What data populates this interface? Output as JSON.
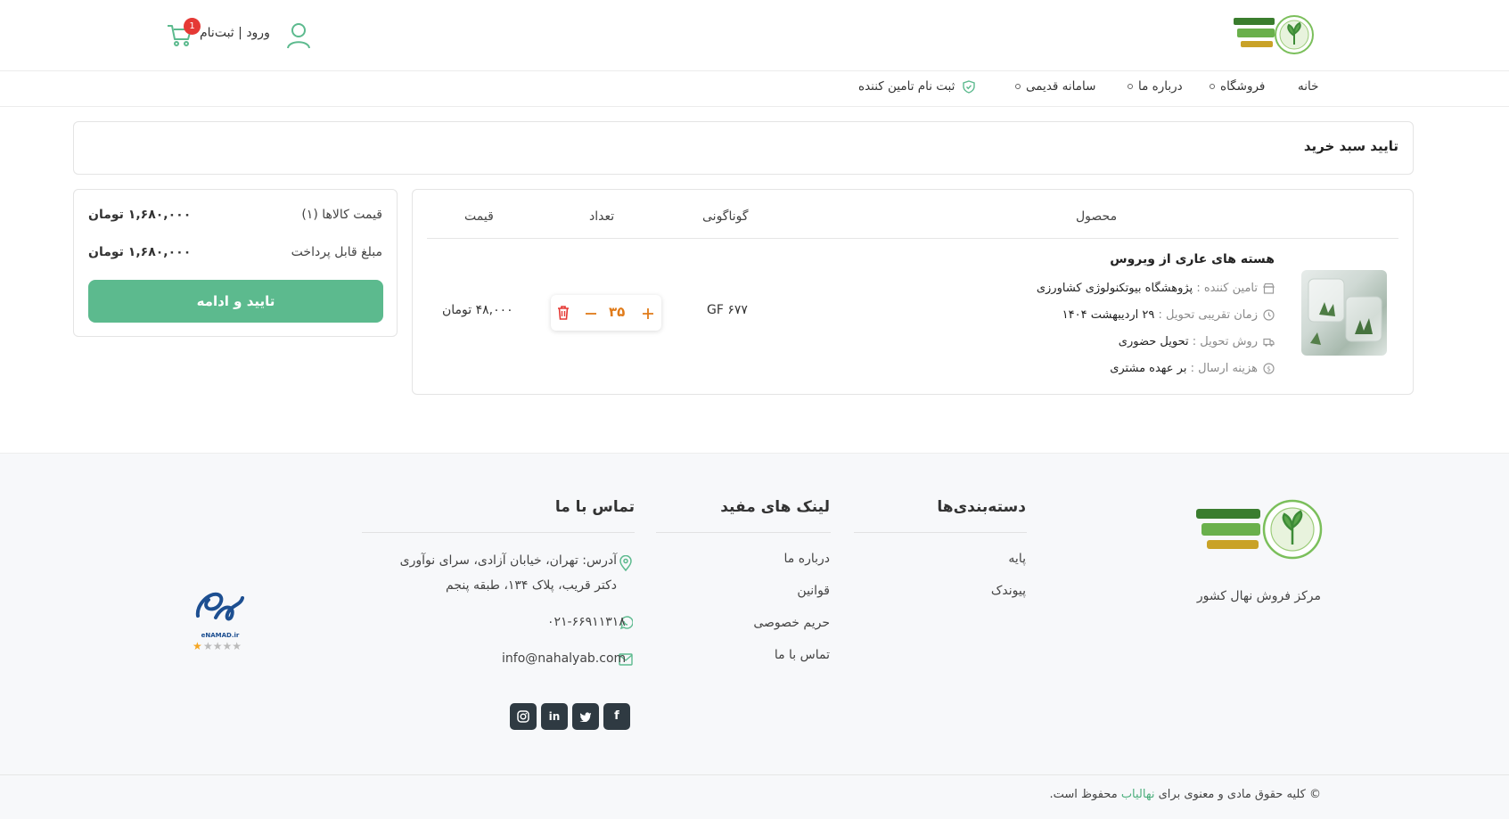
{
  "header": {
    "logo_alt": "صندوق حمایت از توسعه نهال در بخش کشاورزی",
    "login_label": "ورود | ثبت‌نام",
    "cart_count": "1"
  },
  "nav": {
    "items": [
      {
        "label": "خانه"
      },
      {
        "label": "فروشگاه"
      },
      {
        "label": "درباره ما"
      },
      {
        "label": "سامانه قدیمی"
      },
      {
        "label": "ثبت نام تامین کننده"
      }
    ]
  },
  "page": {
    "title": "تایید سبد خرید"
  },
  "cart_table": {
    "headers": {
      "product": "محصول",
      "variant": "گوناگونی",
      "quantity": "تعداد",
      "price": "قیمت"
    },
    "item": {
      "name": "هسته های عاری از ویروس",
      "supplier_label": "تامین کننده :",
      "supplier": "پژوهشگاه بیوتکنولوژی کشاورزی",
      "delivery_time_label": "زمان تقریبی تحویل :",
      "delivery_time": "۲۹ اردیبهشت ۱۴۰۴",
      "delivery_method_label": "روش تحویل :",
      "delivery_method": "تحویل حضوری",
      "shipping_label": "هزینه ارسال :",
      "shipping": "بر عهده مشتری",
      "variant": "GF ۶۷۷",
      "quantity": "۳۵",
      "price": "۴۸,۰۰۰ تومان"
    }
  },
  "summary": {
    "items_price_label": "قیمت کالاها (۱)",
    "items_price": "۱,۶۸۰,۰۰۰ تومان",
    "payable_label": "مبلغ قابل پرداخت",
    "payable": "۱,۶۸۰,۰۰۰ تومان",
    "confirm_label": "تایید و ادامه"
  },
  "footer": {
    "brand_caption": "مرکز فروش نهال کشور",
    "categories_title": "دسته‌بندی‌ها",
    "categories": [
      "پایه",
      "پیوندک"
    ],
    "links_title": "لینک های مفید",
    "links": [
      "درباره ما",
      "قوانین",
      "حریم خصوصی",
      "تماس با ما"
    ],
    "contact_title": "تماس با ما",
    "address_line1": "آدرس: تهران، خیابان آزادی، سرای نوآوری",
    "address_line2": "دکتر قریب، پلاک ۱۳۴، طبقه پنجم",
    "phone": "۰۲۱-۶۶۹۱۱۳۱۸",
    "email": "info@nahalyab.com",
    "enamad_text": "eNAMAD.ir",
    "copyright_prefix": "© کلیه حقوق مادی و معنوی برای",
    "copyright_brand": "نهالیاب",
    "copyright_suffix": "محفوظ است."
  },
  "colors": {
    "accent": "#5cba8e",
    "badge": "#e53935",
    "quantity": "#e07b1a"
  }
}
